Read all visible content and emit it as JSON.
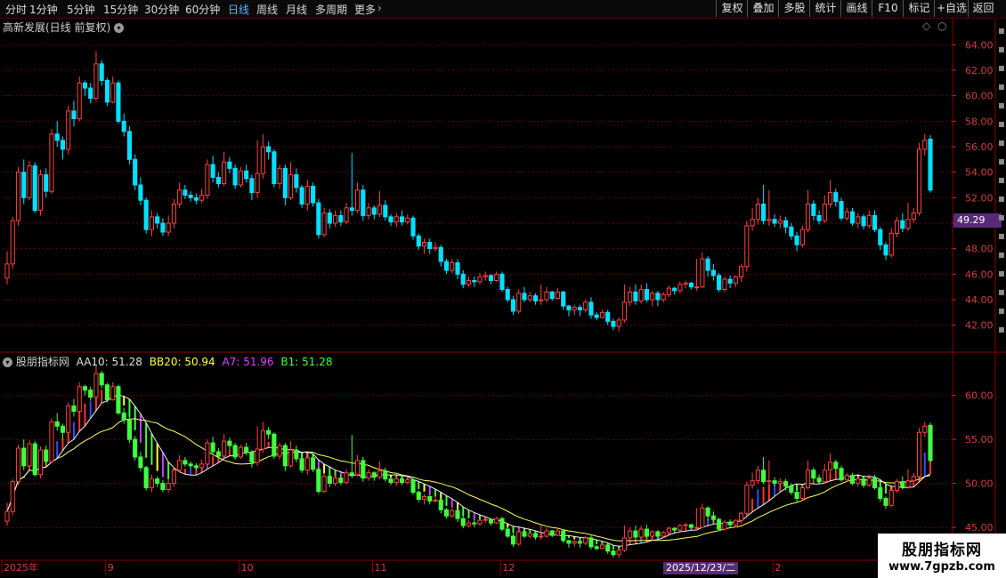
{
  "toolbar": {
    "periods": [
      "分时",
      "1分钟",
      "5分钟",
      "15分钟",
      "30分钟",
      "60分钟",
      "日线",
      "周线",
      "月线",
      "多周期",
      "更多"
    ],
    "active_period": "日线",
    "tools": [
      "复权",
      "叠加",
      "多股",
      "统计",
      "画线",
      "F10",
      "标记",
      "+自选",
      "返回"
    ]
  },
  "main_panel": {
    "title": "高新发展(日线 前复权)",
    "last_price": "49.29",
    "y_ticks": [
      "64.00",
      "62.00",
      "60.00",
      "58.00",
      "56.00",
      "54.00",
      "52.00",
      "50.00",
      "48.00",
      "46.00",
      "44.00",
      "42.00"
    ]
  },
  "indicator_panel": {
    "name": "股朋指标网",
    "aa10": "AA10: 51.28",
    "bb20": "BB20: 50.94",
    "a7": "A7: 51.96",
    "b1": "B1: 51.28",
    "y_ticks": [
      "60.00",
      "55.00",
      "50.00",
      "45.00"
    ]
  },
  "x_axis": {
    "labels": [
      "2025年",
      "9",
      "10",
      "11",
      "12",
      "2"
    ],
    "cursor_date": "2025/12/23/二"
  },
  "watermark": {
    "name": "股朋指标网",
    "url": "www.7gpzb.com"
  },
  "colors": {
    "up": "#ff4040",
    "down": "#00e0ff",
    "ind_down": "#40ff40",
    "grid": "#6a0000",
    "axis": "#8a0000"
  },
  "chart_data": {
    "type": "candlestick",
    "ylim_main": [
      41,
      65
    ],
    "ylim_indicator": [
      44.3,
      63
    ],
    "candles": [
      [
        45.7,
        46.8,
        45.2,
        47.8
      ],
      [
        46.8,
        50.2,
        46.4,
        50.5
      ],
      [
        50.2,
        54.0,
        49.8,
        54.4
      ],
      [
        54.0,
        52.0,
        51.5,
        55.0
      ],
      [
        52.0,
        54.5,
        51.8,
        54.9
      ],
      [
        54.5,
        51.0,
        50.8,
        54.8
      ],
      [
        51.0,
        53.8,
        50.6,
        54.2
      ],
      [
        53.8,
        52.5,
        52.0,
        54.3
      ],
      [
        52.5,
        57.0,
        52.3,
        57.4
      ],
      [
        57.0,
        56.5,
        56.0,
        58.0
      ],
      [
        56.5,
        55.8,
        55.0,
        56.8
      ],
      [
        55.8,
        58.8,
        55.4,
        59.2
      ],
      [
        58.8,
        58.2,
        57.6,
        59.6
      ],
      [
        58.2,
        61.0,
        58.0,
        61.5
      ],
      [
        61.0,
        60.6,
        60.0,
        61.2
      ],
      [
        60.6,
        59.8,
        59.4,
        61.0
      ],
      [
        59.8,
        62.5,
        59.6,
        63.5
      ],
      [
        62.5,
        61.2,
        60.8,
        62.8
      ],
      [
        61.2,
        59.5,
        59.2,
        61.4
      ],
      [
        59.5,
        61.0,
        59.4,
        61.5
      ],
      [
        61.0,
        58.0,
        57.8,
        61.2
      ],
      [
        58.0,
        57.2,
        56.8,
        58.6
      ],
      [
        57.2,
        55.0,
        54.6,
        57.6
      ],
      [
        55.0,
        53.0,
        52.6,
        55.4
      ],
      [
        53.0,
        51.8,
        51.4,
        53.6
      ],
      [
        51.8,
        49.5,
        49.2,
        52.0
      ],
      [
        49.5,
        50.5,
        49.0,
        51.0
      ],
      [
        50.5,
        50.0,
        49.6,
        50.8
      ],
      [
        50.0,
        49.3,
        49.0,
        50.4
      ],
      [
        49.3,
        50.0,
        49.0,
        50.6
      ],
      [
        50.0,
        51.5,
        49.6,
        51.9
      ],
      [
        51.5,
        52.6,
        51.2,
        53.2
      ],
      [
        52.6,
        52.2,
        51.9,
        53.0
      ],
      [
        52.2,
        52.0,
        51.7,
        52.5
      ],
      [
        52.0,
        51.8,
        51.5,
        52.3
      ],
      [
        51.8,
        52.2,
        51.6,
        52.7
      ],
      [
        52.2,
        54.6,
        51.9,
        55.0
      ],
      [
        54.6,
        53.6,
        53.2,
        55.3
      ],
      [
        53.6,
        53.1,
        52.8,
        54.0
      ],
      [
        53.1,
        54.8,
        52.9,
        55.6
      ],
      [
        54.8,
        54.3,
        53.9,
        55.2
      ],
      [
        54.3,
        53.0,
        52.7,
        54.6
      ],
      [
        53.0,
        54.1,
        52.8,
        54.4
      ],
      [
        54.1,
        53.5,
        53.2,
        54.6
      ],
      [
        53.5,
        52.4,
        51.8,
        53.8
      ],
      [
        52.4,
        53.9,
        52.0,
        56.5
      ],
      [
        53.9,
        56.0,
        53.5,
        57.0
      ],
      [
        56.0,
        55.6,
        55.0,
        56.4
      ],
      [
        55.6,
        53.1,
        52.8,
        55.8
      ],
      [
        53.1,
        54.3,
        52.7,
        54.6
      ],
      [
        54.3,
        52.0,
        51.4,
        54.6
      ],
      [
        52.0,
        53.8,
        51.8,
        54.8
      ],
      [
        53.8,
        52.8,
        52.4,
        54.3
      ],
      [
        52.8,
        51.5,
        51.2,
        53.0
      ],
      [
        51.5,
        52.9,
        51.0,
        53.4
      ],
      [
        52.9,
        51.6,
        51.3,
        53.2
      ],
      [
        51.6,
        49.1,
        48.8,
        51.9
      ],
      [
        49.1,
        50.8,
        48.9,
        51.2
      ],
      [
        50.8,
        50.0,
        49.6,
        51.1
      ],
      [
        50.0,
        50.6,
        49.7,
        51.0
      ],
      [
        50.6,
        50.1,
        49.8,
        51.0
      ],
      [
        50.1,
        51.2,
        49.9,
        51.6
      ],
      [
        51.2,
        51.0,
        50.6,
        55.5
      ],
      [
        51.0,
        52.6,
        50.8,
        53.2
      ],
      [
        52.6,
        50.6,
        50.2,
        53.0
      ],
      [
        50.6,
        51.2,
        50.3,
        51.6
      ],
      [
        51.2,
        50.7,
        50.3,
        51.4
      ],
      [
        50.7,
        51.4,
        50.5,
        52.5
      ],
      [
        51.4,
        50.5,
        50.2,
        51.8
      ],
      [
        50.5,
        50.1,
        49.8,
        50.7
      ],
      [
        50.1,
        50.5,
        49.7,
        50.8
      ],
      [
        50.5,
        50.1,
        49.8,
        51.0
      ],
      [
        50.1,
        50.4,
        49.9,
        50.7
      ],
      [
        50.4,
        49.0,
        48.7,
        50.6
      ],
      [
        49.0,
        48.2,
        47.9,
        49.2
      ],
      [
        48.2,
        48.5,
        47.6,
        48.8
      ],
      [
        48.5,
        48.0,
        47.6,
        48.8
      ],
      [
        48.0,
        48.1,
        47.8,
        48.5
      ],
      [
        48.1,
        47.0,
        46.6,
        48.3
      ],
      [
        47.0,
        46.3,
        46.0,
        47.2
      ],
      [
        46.3,
        46.9,
        46.1,
        47.2
      ],
      [
        46.9,
        46.0,
        45.6,
        47.2
      ],
      [
        46.0,
        45.2,
        44.9,
        46.3
      ],
      [
        45.2,
        45.5,
        45.0,
        45.8
      ],
      [
        45.5,
        45.4,
        45.0,
        45.8
      ],
      [
        45.4,
        45.8,
        45.2,
        46.1
      ],
      [
        45.8,
        45.9,
        45.5,
        46.2
      ],
      [
        45.9,
        45.5,
        45.2,
        46.0
      ],
      [
        45.5,
        46.0,
        45.4,
        46.2
      ],
      [
        46.0,
        44.8,
        44.6,
        46.2
      ],
      [
        44.8,
        44.0,
        43.8,
        45.0
      ],
      [
        44.0,
        43.1,
        42.8,
        44.3
      ],
      [
        43.1,
        44.5,
        42.9,
        44.8
      ],
      [
        44.5,
        44.0,
        43.8,
        45.0
      ],
      [
        44.0,
        44.3,
        43.8,
        44.6
      ],
      [
        44.3,
        43.9,
        43.6,
        44.5
      ],
      [
        43.9,
        44.0,
        43.6,
        45.2
      ],
      [
        44.0,
        44.6,
        43.8,
        45.0
      ],
      [
        44.6,
        44.1,
        43.9,
        44.7
      ],
      [
        44.1,
        44.6,
        44.0,
        44.9
      ],
      [
        44.6,
        43.5,
        43.2,
        44.7
      ],
      [
        43.5,
        43.2,
        42.7,
        43.6
      ],
      [
        43.2,
        43.4,
        42.8,
        43.6
      ],
      [
        43.4,
        43.2,
        42.7,
        43.6
      ],
      [
        43.2,
        43.8,
        43.0,
        44.0
      ],
      [
        43.8,
        42.8,
        42.5,
        44.2
      ],
      [
        42.8,
        42.6,
        42.4,
        43.0
      ],
      [
        42.6,
        43.0,
        42.5,
        43.2
      ],
      [
        43.0,
        42.3,
        42.0,
        43.2
      ],
      [
        42.3,
        41.9,
        41.6,
        42.5
      ],
      [
        41.9,
        42.4,
        41.5,
        42.6
      ],
      [
        42.4,
        43.8,
        42.2,
        45.2
      ],
      [
        43.8,
        44.6,
        43.5,
        45.0
      ],
      [
        44.6,
        43.9,
        43.6,
        45.2
      ],
      [
        43.9,
        44.8,
        43.7,
        45.2
      ],
      [
        44.8,
        44.0,
        43.8,
        45.3
      ],
      [
        44.0,
        44.5,
        43.5,
        44.7
      ],
      [
        44.5,
        44.0,
        43.5,
        44.7
      ],
      [
        44.0,
        44.4,
        43.8,
        44.6
      ],
      [
        44.4,
        44.9,
        44.2,
        45.1
      ],
      [
        44.9,
        44.7,
        44.4,
        45.0
      ],
      [
        44.7,
        45.2,
        44.5,
        45.4
      ],
      [
        45.2,
        45.3,
        44.9,
        45.5
      ],
      [
        45.3,
        45.0,
        44.8,
        45.4
      ],
      [
        45.0,
        45.0,
        44.7,
        47.2
      ],
      [
        45.0,
        47.2,
        44.9,
        47.7
      ],
      [
        47.2,
        46.3,
        45.8,
        47.4
      ],
      [
        46.3,
        45.9,
        45.5,
        46.8
      ],
      [
        45.9,
        44.8,
        44.6,
        46.1
      ],
      [
        44.8,
        45.6,
        44.6,
        45.8
      ],
      [
        45.6,
        45.3,
        44.9,
        45.9
      ],
      [
        45.3,
        45.8,
        45.0,
        45.9
      ],
      [
        45.8,
        46.6,
        45.4,
        46.8
      ],
      [
        46.6,
        49.8,
        46.2,
        50.2
      ],
      [
        49.8,
        50.3,
        49.4,
        51.2
      ],
      [
        50.3,
        51.5,
        49.9,
        52.0
      ],
      [
        51.5,
        50.2,
        49.9,
        53.0
      ],
      [
        50.2,
        50.3,
        49.8,
        52.6
      ],
      [
        50.3,
        50.0,
        49.7,
        50.7
      ],
      [
        50.0,
        50.2,
        49.6,
        50.6
      ],
      [
        50.2,
        49.7,
        49.2,
        50.5
      ],
      [
        49.7,
        49.0,
        48.7,
        50.0
      ],
      [
        49.0,
        48.3,
        47.8,
        49.3
      ],
      [
        48.3,
        49.5,
        48.1,
        49.8
      ],
      [
        49.5,
        51.5,
        49.3,
        52.6
      ],
      [
        51.5,
        50.6,
        50.2,
        51.8
      ],
      [
        50.6,
        50.2,
        49.9,
        51.0
      ],
      [
        50.2,
        51.5,
        50.0,
        52.2
      ],
      [
        51.5,
        52.4,
        51.2,
        53.4
      ],
      [
        52.4,
        51.7,
        51.3,
        52.7
      ],
      [
        51.7,
        50.4,
        50.2,
        52.0
      ],
      [
        50.4,
        50.9,
        50.2,
        51.2
      ],
      [
        50.9,
        50.0,
        49.8,
        51.2
      ],
      [
        50.0,
        50.5,
        49.6,
        50.8
      ],
      [
        50.5,
        49.8,
        49.5,
        50.7
      ],
      [
        49.8,
        50.6,
        49.6,
        51.0
      ],
      [
        50.6,
        49.5,
        49.3,
        51.0
      ],
      [
        49.5,
        48.3,
        47.9,
        49.7
      ],
      [
        48.3,
        47.5,
        47.1,
        48.5
      ],
      [
        47.5,
        49.2,
        47.3,
        49.6
      ],
      [
        49.2,
        50.2,
        48.9,
        50.5
      ],
      [
        50.2,
        49.6,
        49.3,
        50.8
      ],
      [
        49.6,
        50.3,
        49.4,
        51.6
      ],
      [
        50.3,
        50.8,
        50.0,
        51.2
      ],
      [
        50.8,
        55.8,
        50.6,
        56.3
      ],
      [
        55.8,
        56.5,
        55.3,
        57.0
      ],
      [
        56.6,
        52.6,
        52.4,
        56.9
      ]
    ],
    "ma_series": [
      {
        "name": "AA10",
        "last": 51.28
      },
      {
        "name": "BB20",
        "last": 50.94
      },
      {
        "name": "A7",
        "last": 51.96
      },
      {
        "name": "B1",
        "last": 51.28
      }
    ]
  }
}
